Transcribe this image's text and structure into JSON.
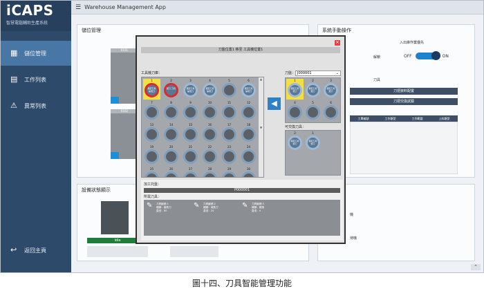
{
  "sidebar": {
    "logo": "iCAPS",
    "subtitle": "智慧電腦輔助生產系統",
    "items": [
      {
        "label": "儲位管理",
        "icon": "storage-grid-icon"
      },
      {
        "label": "工作列表",
        "icon": "clipboard-icon"
      },
      {
        "label": "異常列表",
        "icon": "alert-person-icon"
      }
    ],
    "back": "返回主頁"
  },
  "topbar": {
    "title": "Warehouse Management App"
  },
  "storage": {
    "title": "儲位管理",
    "loc1": "0101",
    "loc2": "0102"
  },
  "manual": {
    "title": "系統手動操作",
    "priority_label": "入出庫作業優先",
    "off": "OFF",
    "on": "ON",
    "release": "解鎖",
    "tool": "刀具",
    "btn1": "刀把資料配置",
    "btn2": "刀把交換試驗",
    "columns": [
      "工單編號",
      "工作類型",
      "工作範圍",
      "上料類型"
    ]
  },
  "equipment": {
    "title": "設備狀態顯示",
    "status": "Idle",
    "side1": "機",
    "side2": "待機"
  },
  "modal": {
    "title": "刀盤位置1 移至 工具機位置1",
    "machine_magazine": "工具機刀庫：",
    "magazine_label": "刀盤：",
    "magazine_value": "J000001",
    "swap_label": "可交換刀具：",
    "process_label": "加工托盤：",
    "pallet_value": "P000001",
    "required_label": "所需刀具：",
    "slots": [
      {
        "n": "1",
        "t": "搭配刀具 編號刀",
        "yellow": true,
        "red": true
      },
      {
        "n": "2",
        "t": "銑刀 刀具",
        "yellow": false,
        "red": true
      },
      {
        "n": "3",
        "t": "搭配刀具 編號刀",
        "yellow": false,
        "red": false
      },
      {
        "n": "4",
        "t": "搭配刀具 編號刀",
        "yellow": false,
        "red": false
      },
      {
        "n": "5",
        "t": "",
        "yellow": false,
        "red": false
      },
      {
        "n": "6",
        "t": "搭配刀具 編號刀",
        "yellow": false,
        "red": false
      },
      {
        "n": "7",
        "t": "",
        "yellow": false,
        "red": false
      },
      {
        "n": "8",
        "t": "",
        "yellow": false,
        "red": false
      },
      {
        "n": "9",
        "t": "",
        "yellow": false,
        "red": false
      },
      {
        "n": "10",
        "t": "",
        "yellow": false,
        "red": false
      },
      {
        "n": "11",
        "t": "",
        "yellow": false,
        "red": false
      },
      {
        "n": "12",
        "t": "",
        "yellow": false,
        "red": false
      },
      {
        "n": "13",
        "t": "",
        "yellow": false,
        "red": false
      },
      {
        "n": "14",
        "t": "",
        "yellow": false,
        "red": false
      },
      {
        "n": "15",
        "t": "",
        "yellow": false,
        "red": false
      },
      {
        "n": "16",
        "t": "",
        "yellow": false,
        "red": false
      },
      {
        "n": "17",
        "t": "",
        "yellow": false,
        "red": false
      },
      {
        "n": "18",
        "t": "",
        "yellow": false,
        "red": false
      },
      {
        "n": "19",
        "t": "",
        "yellow": false,
        "red": false
      },
      {
        "n": "20",
        "t": "",
        "yellow": false,
        "red": false
      },
      {
        "n": "21",
        "t": "",
        "yellow": false,
        "red": false
      },
      {
        "n": "22",
        "t": "",
        "yellow": false,
        "red": false
      },
      {
        "n": "23",
        "t": "",
        "yellow": false,
        "red": false
      },
      {
        "n": "24",
        "t": "",
        "yellow": false,
        "red": false
      },
      {
        "n": "25",
        "t": "",
        "yellow": false,
        "red": false
      },
      {
        "n": "26",
        "t": "",
        "yellow": false,
        "red": false
      },
      {
        "n": "27",
        "t": "",
        "yellow": false,
        "red": false
      },
      {
        "n": "28",
        "t": "",
        "yellow": false,
        "red": false
      },
      {
        "n": "29",
        "t": "",
        "yellow": false,
        "red": false
      },
      {
        "n": "30",
        "t": "",
        "yellow": false,
        "red": false
      }
    ],
    "mag_slots": [
      {
        "n": "1",
        "t": "搭配刀具 銑刀",
        "yellow": true
      },
      {
        "n": "2",
        "t": "搭配刀具 銑刀",
        "yellow": false
      },
      {
        "n": "3",
        "t": "搭配刀具 銑刀",
        "yellow": false
      },
      {
        "n": "4",
        "t": "",
        "yellow": false
      },
      {
        "n": "5",
        "t": "",
        "yellow": false
      },
      {
        "n": "6",
        "t": "",
        "yellow": false
      }
    ],
    "swap_slots": [
      {
        "n": "2",
        "t": "搭配刀具 銑刀"
      },
      {
        "n": "1",
        "t": "搭配刀具 銑刀"
      }
    ],
    "tools": [
      {
        "line1": "刀具編號:1",
        "line2": "種類：面銑刀",
        "line3": "直徑：80"
      },
      {
        "line1": "刀具編號:2",
        "line2": "種類：端銑刀",
        "line3": "直徑：20"
      },
      {
        "line1": "刀具編號:3",
        "line2": "種類：鑽頭",
        "line3": "直徑：4"
      }
    ]
  },
  "caption": "圖十四、刀具智能管理功能",
  "colors": {
    "sidebar": "#2e4a6b",
    "active": "#4876a5",
    "accent": "#1a83d0",
    "highlight": "#f3df42",
    "alert": "#d92b2b"
  }
}
